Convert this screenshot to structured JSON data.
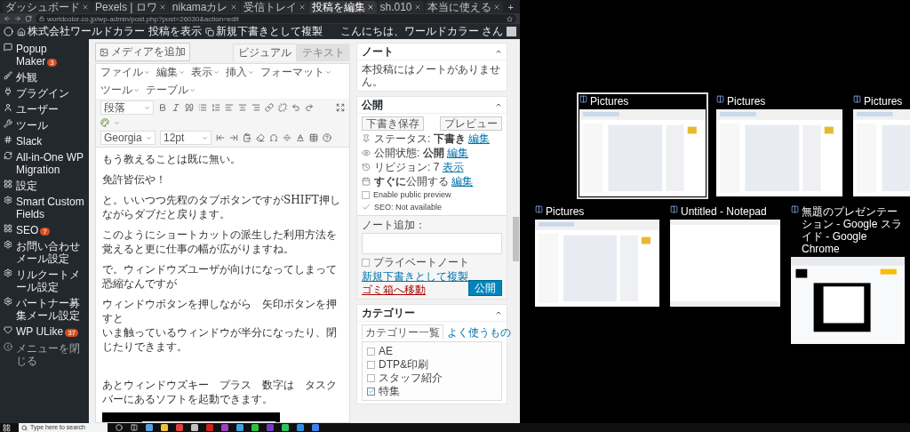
{
  "browser": {
    "tabs": [
      {
        "title": "ダッシュボード",
        "selected": false
      },
      {
        "title": "Pexels | ロワ",
        "selected": false
      },
      {
        "title": "nikamaカレ",
        "selected": false
      },
      {
        "title": "受信トレイ",
        "selected": false
      },
      {
        "title": "投稿を編集",
        "selected": true
      },
      {
        "title": "sh.010",
        "selected": false
      },
      {
        "title": "本当に使える",
        "selected": false
      }
    ],
    "new_tab": "+",
    "address": "worldcolor.co.jp/wp-admin/post.php?post=26030&action=edit"
  },
  "admin_bar": {
    "site": "株式会社ワールドカラー",
    "view_post": "投稿を表示",
    "duplicate": "新規下書きとして複製",
    "greeting": "こんにちは、ワールドカラー さん"
  },
  "sidebar": {
    "items": [
      {
        "label": "Popup Maker",
        "badge": "3"
      },
      {
        "label": "外観"
      },
      {
        "label": "プラグイン"
      },
      {
        "label": "ユーザー"
      },
      {
        "label": "ツール"
      },
      {
        "label": "Slack"
      },
      {
        "label": "All-in-One WP Migration"
      },
      {
        "label": "設定"
      },
      {
        "label": "Smart Custom Fields"
      },
      {
        "label": "SEO",
        "badge": "7"
      },
      {
        "label": "お問い合わせメール設定"
      },
      {
        "label": "リルクートメール設定"
      },
      {
        "label": "パートナー募集メール設定"
      },
      {
        "label": "WP ULike",
        "badge": "37"
      }
    ],
    "collapse": "メニューを閉じる"
  },
  "editor": {
    "add_media": "メディアを追加",
    "modes": [
      {
        "label": "ビジュアル",
        "selected": true
      },
      {
        "label": "テキスト",
        "selected": false
      }
    ],
    "menus": [
      "ファイル",
      "編集",
      "表示",
      "挿入",
      "フォーマット",
      "ツール",
      "テーブル"
    ],
    "format_select": "段落",
    "font_select": "Georgia",
    "size_select": "12pt",
    "paragraphs": [
      [
        "もう教えることは既に無い。"
      ],
      [
        "免許皆伝や！"
      ],
      [
        "と。いいつつ先程のタブボタンですがSHIFT押しながらダブだと戻ります。"
      ],
      [
        "このようにショートカットの派生した利用方法を覚えると更に仕事の幅が広がりますね。"
      ],
      [
        "で。ウィンドウズユーザが向けになってしまって恐縮なんですが"
      ],
      [
        "ウィンドウボタンを押しながら　矢印ボタンを押すと",
        "いま触っているウィンドウが半分になったり、閉じたりできます。"
      ],
      [
        "あとウィンドウズキー　プラス　数字は　タスクバーにあるソフトを起動できます。"
      ]
    ],
    "image": {
      "kind": "picture"
    }
  },
  "notes_box": {
    "title": "ノート",
    "text": "本投稿にはノートがありません。"
  },
  "publish_box": {
    "title": "公開",
    "save_draft": "下書き保存",
    "preview": "プレビュー",
    "rows": [
      {
        "kind": "status",
        "text": "ステータス: **下書き**",
        "link": "編集"
      },
      {
        "kind": "visibility",
        "text": "公開状態: **公開**",
        "link": "編集"
      },
      {
        "kind": "revisions",
        "text": "リビジョン: 7",
        "link": "表示"
      },
      {
        "kind": "schedule",
        "text": "**すぐに**公開する",
        "link": "編集"
      }
    ],
    "public_preview": {
      "label": "Enable public preview",
      "checked": false
    },
    "seo": "SEO: Not available",
    "note_label": "ノート追加：",
    "private_note": {
      "label": "プライベートノート",
      "checked": false
    },
    "duplicate_link": "新規下書きとして複製",
    "trash_link": "ゴミ箱へ移動",
    "publish": "公開"
  },
  "category_box": {
    "title": "カテゴリー",
    "tabs": [
      {
        "label": "カテゴリー一覧",
        "selected": true
      },
      {
        "label": "よく使うもの",
        "selected": false
      }
    ],
    "items": [
      {
        "label": "AE",
        "checked": false
      },
      {
        "label": "DTP&印刷",
        "checked": false
      },
      {
        "label": "スタッフ紹介",
        "checked": false
      },
      {
        "label": "特集",
        "checked": true
      }
    ]
  },
  "task_view": {
    "rows": [
      [
        {
          "title": "Pictures",
          "kind": "explorer",
          "selected": true
        },
        {
          "title": "Pictures",
          "kind": "explorer",
          "selected": false
        },
        {
          "title": "Pictures",
          "kind": "explorer",
          "selected": false
        }
      ],
      [
        {
          "title": "Pictures",
          "kind": "explorer",
          "selected": false
        },
        {
          "title": "Untitled - Notepad",
          "kind": "notepad",
          "selected": false
        },
        {
          "title": "無題のプレゼンテーション - Google スライド - Google Chrome",
          "kind": "slides",
          "selected": false
        }
      ]
    ]
  },
  "taskbar": {
    "search_placeholder": "Type here to search"
  }
}
